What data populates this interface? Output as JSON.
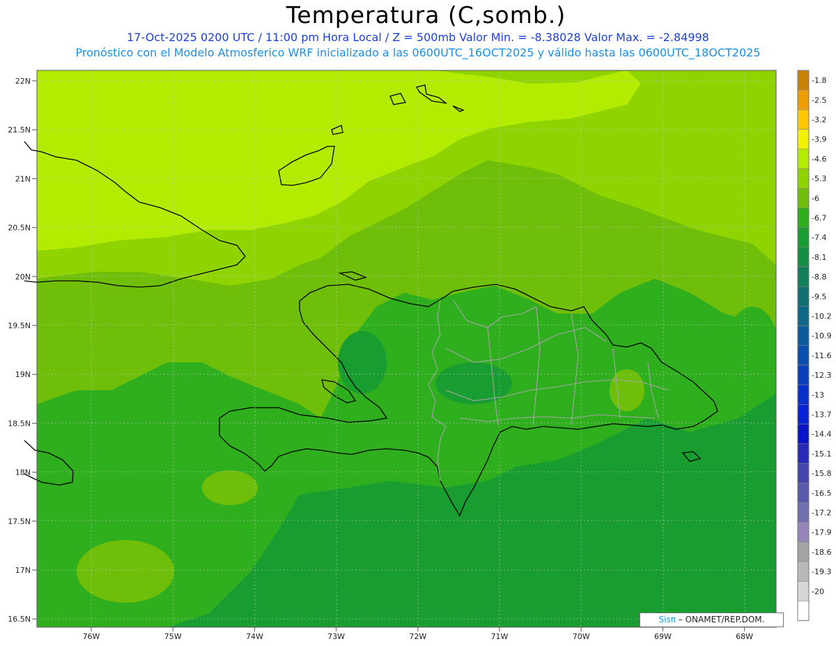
{
  "header": {
    "title": "Temperatura (C,somb.)",
    "line1": "17-Oct-2025  0200 UTC / 11:00 pm Hora Local / Z = 500mb  Valor Min. = -8.38028  Valor Max. = -2.84998",
    "line2": "Pronóstico con el Modelo Atmosferico WRF inicializado a las 0600UTC_16OCT2025 y válido hasta las  0600UTC_18OCT2025"
  },
  "map_data": {
    "lat_ticks": [
      "22N",
      "21.5N",
      "21N",
      "20.5N",
      "20N",
      "19.5N",
      "19N",
      "18.5N",
      "18N",
      "17.5N",
      "17N",
      "16.5N"
    ],
    "lon_ticks": [
      "76W",
      "75W",
      "74W",
      "73W",
      "72W",
      "71W",
      "70W",
      "69W",
      "68W"
    ],
    "grid_lines": "dotted",
    "field_colors": {
      "c_46": "#b3ec00",
      "c_53": "#8fd400",
      "c_60": "#6fbf0a",
      "c_67": "#2fae1e",
      "c_74": "#199d30"
    },
    "colorbar": [
      {
        "label": "-1.8",
        "color": "#c98408"
      },
      {
        "label": "-2.5",
        "color": "#ee9d00"
      },
      {
        "label": "-3.2",
        "color": "#ffc800"
      },
      {
        "label": "-3.9",
        "color": "#f2f200"
      },
      {
        "label": "-4.6",
        "color": "#b3ec00"
      },
      {
        "label": "-5.3",
        "color": "#8fd400"
      },
      {
        "label": "-6",
        "color": "#6fbf0a"
      },
      {
        "label": "-6.7",
        "color": "#2fae1e"
      },
      {
        "label": "-7.4",
        "color": "#199d30"
      },
      {
        "label": "-8.1",
        "color": "#158d45"
      },
      {
        "label": "-8.8",
        "color": "#127e5c"
      },
      {
        "label": "-9.5",
        "color": "#0f7171"
      },
      {
        "label": "-10.2",
        "color": "#0d6887"
      },
      {
        "label": "-10.9",
        "color": "#0c5b9c"
      },
      {
        "label": "-11.6",
        "color": "#0b4fae"
      },
      {
        "label": "-12.3",
        "color": "#0a3fbe"
      },
      {
        "label": "-13",
        "color": "#0831cc"
      },
      {
        "label": "-13.7",
        "color": "#0723d6"
      },
      {
        "label": "-14.4",
        "color": "#0a14c8"
      },
      {
        "label": "-15.1",
        "color": "#2a2ab8"
      },
      {
        "label": "-15.8",
        "color": "#4545b0"
      },
      {
        "label": "-16.5",
        "color": "#5a5aac"
      },
      {
        "label": "-17.2",
        "color": "#7070b0"
      },
      {
        "label": "-17.9",
        "color": "#9585b8"
      },
      {
        "label": "-18.6",
        "color": "#a3a3a3"
      },
      {
        "label": "-19.3",
        "color": "#b8b8b8"
      },
      {
        "label": "-20",
        "color": "#d6d6d6"
      },
      {
        "label": "",
        "color": "#ffffff"
      }
    ]
  },
  "credit": {
    "sis": "Sisπ",
    "org": " –  ONAMET/REP.DOM."
  }
}
